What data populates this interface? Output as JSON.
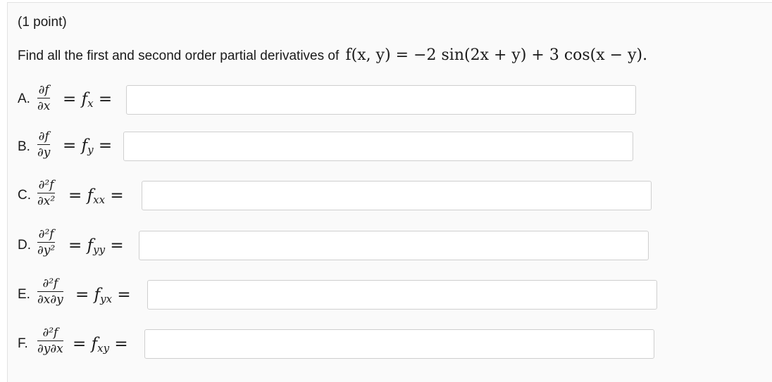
{
  "header": {
    "points": "(1 point)"
  },
  "instruction": {
    "text": "Find all the first and second order partial derivatives of",
    "equation": "f(x, y) = −2 sin(2x + y) + 3 cos(x − y)."
  },
  "questions": [
    {
      "letter": "A.",
      "num": "∂f",
      "den": "∂x",
      "rhs": "= f",
      "sub": "x",
      "value": ""
    },
    {
      "letter": "B.",
      "num": "∂f",
      "den": "∂y",
      "rhs": "= f",
      "sub": "y",
      "value": ""
    },
    {
      "letter": "C.",
      "num": "∂²f",
      "den": "∂x²",
      "rhs": "= f",
      "sub": "xx",
      "value": ""
    },
    {
      "letter": "D.",
      "num": "∂²f",
      "den": "∂y²",
      "rhs": "= f",
      "sub": "yy",
      "value": ""
    },
    {
      "letter": "E.",
      "num": "∂²f",
      "den": "∂x∂y",
      "rhs": "= f",
      "sub": "yx",
      "value": ""
    },
    {
      "letter": "F.",
      "num": "∂²f",
      "den": "∂y∂x",
      "rhs": "= f",
      "sub": "xy",
      "value": ""
    }
  ],
  "equals": "="
}
